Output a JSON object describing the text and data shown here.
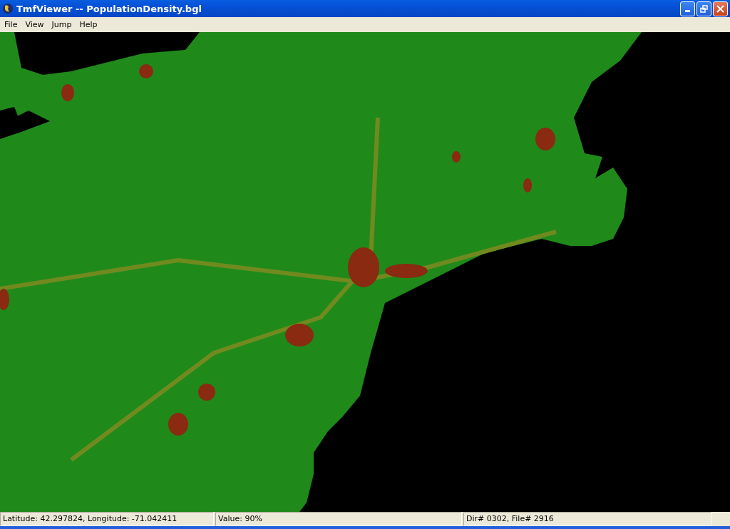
{
  "window": {
    "title": "TmfViewer -- PopulationDensity.bgl"
  },
  "menu": [
    {
      "label": "File"
    },
    {
      "label": "View"
    },
    {
      "label": "Jump"
    },
    {
      "label": "Help"
    }
  ],
  "status_bar": [
    {
      "text": "Latitude: 42.297824, Longitude: -71.042411"
    },
    {
      "text": "Value: 90%"
    },
    {
      "text": "Dir# 0302, File# 2916"
    }
  ]
}
